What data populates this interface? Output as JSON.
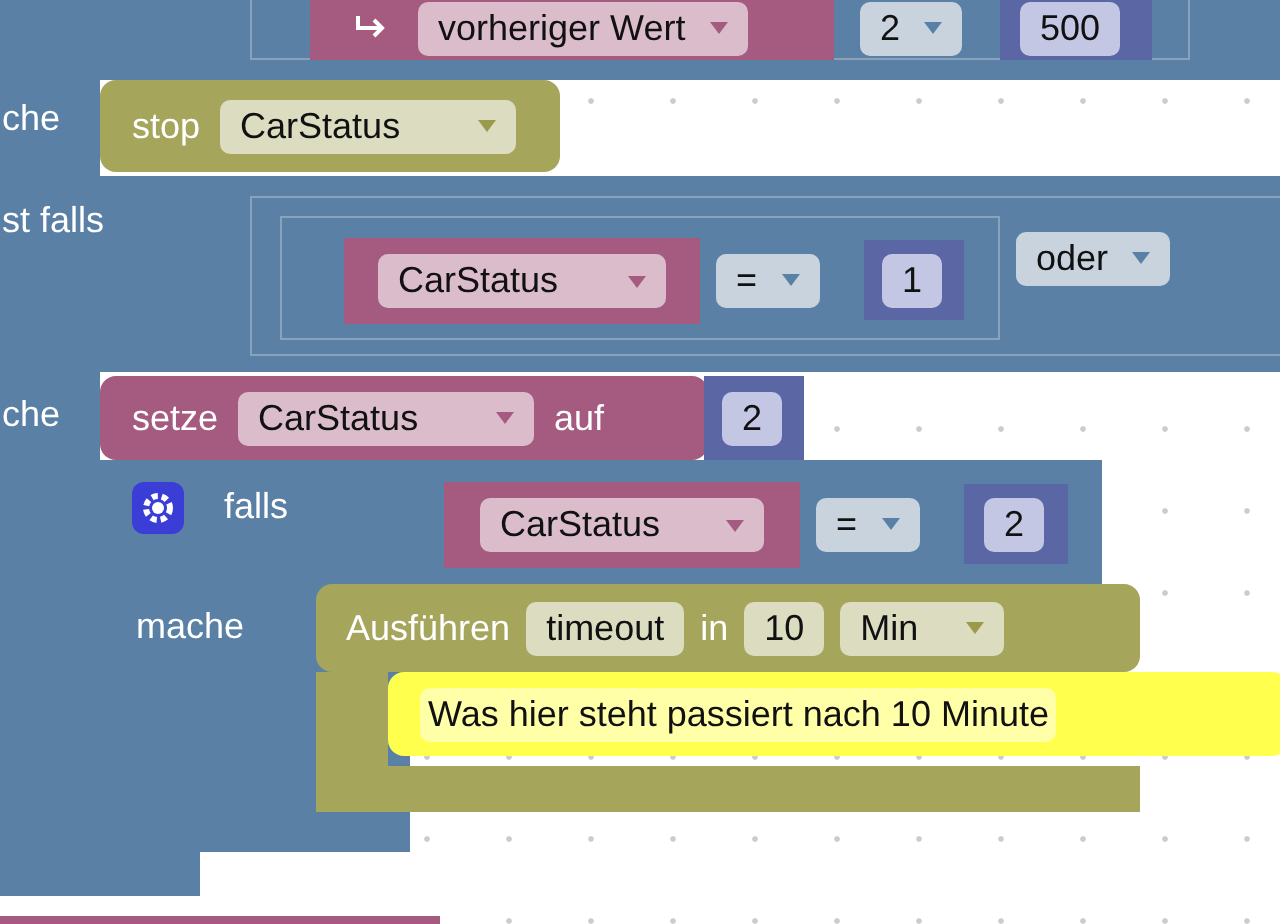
{
  "top_row": {
    "dropdown": "vorheriger Wert",
    "count": "2",
    "value": "500"
  },
  "side_labels": [
    "che",
    "st falls",
    "che"
  ],
  "stop_block": {
    "keyword": "stop",
    "variable": "CarStatus"
  },
  "else_if_condition": {
    "variable": "CarStatus",
    "operator": "=",
    "value": "1",
    "joiner": "oder"
  },
  "set_block": {
    "keyword": "setze",
    "variable": "CarStatus",
    "connector": "auf",
    "value": "2"
  },
  "if_block": {
    "keyword": "falls",
    "do_label": "mache",
    "condition": {
      "variable": "CarStatus",
      "operator": "=",
      "value": "2"
    }
  },
  "timeout_block": {
    "keyword": "Ausführen",
    "name": "timeout",
    "connector": "in",
    "amount": "10",
    "unit": "Min"
  },
  "comment_block": {
    "text": "Was hier steht passiert nach 10 Minute"
  }
}
